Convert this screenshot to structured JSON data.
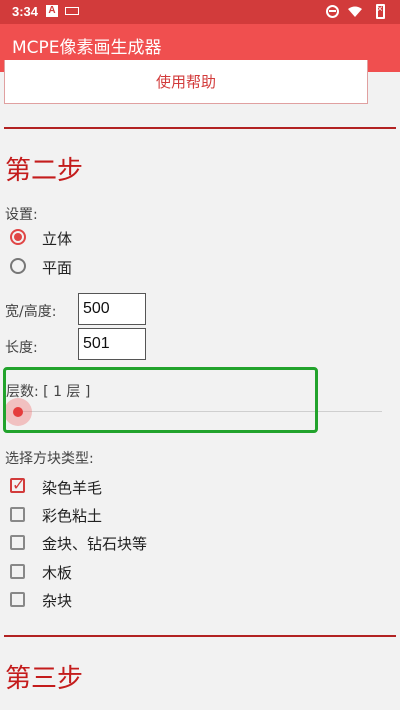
{
  "status_bar": {
    "time": "3:34",
    "notification_glyph": "A"
  },
  "app_bar": {
    "title": "MCPE像素画生成器"
  },
  "help_button": {
    "label": "使用帮助"
  },
  "step2": {
    "title": "第二步",
    "settings_label": "设置:",
    "mode_options": [
      {
        "label": "立体",
        "selected": true
      },
      {
        "label": "平面",
        "selected": false
      }
    ],
    "width_height": {
      "label": "宽/高度:",
      "value": "500"
    },
    "length": {
      "label": "长度:",
      "value": "501"
    },
    "layers": {
      "label": "层数: [ 1 层 ]",
      "value": 1
    },
    "block_types_label": "选择方块类型:",
    "block_types": [
      {
        "label": "染色羊毛",
        "checked": true
      },
      {
        "label": "彩色粘土",
        "checked": false
      },
      {
        "label": "金块、钻石块等",
        "checked": false
      },
      {
        "label": "木板",
        "checked": false
      },
      {
        "label": "杂块",
        "checked": false
      }
    ]
  },
  "step3": {
    "title": "第三步"
  },
  "colors": {
    "accent": "#f04f4f",
    "title_red": "#c41c1c",
    "highlight_green": "#22a32c"
  }
}
